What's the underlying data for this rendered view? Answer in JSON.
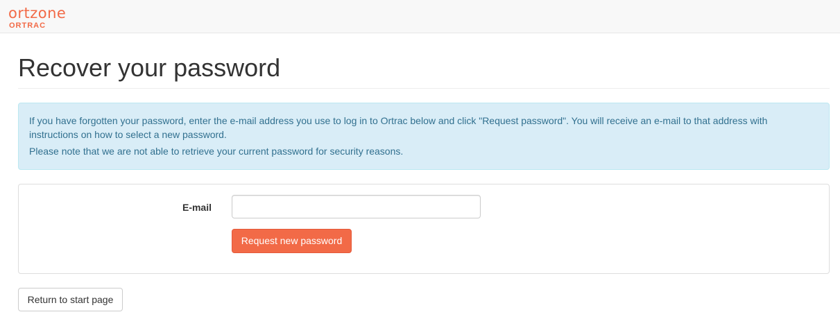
{
  "header": {
    "logo_main": "ortzone",
    "logo_sub": "ORTRAC"
  },
  "page": {
    "title": "Recover your password"
  },
  "info": {
    "paragraph1": "If you have forgotten your password, enter the e-mail address you use to log in to Ortrac below and click \"Request password\". You will receive an e-mail to that address with instructions on how to select a new password.",
    "paragraph2": "Please note that we are not able to retrieve your current password for security reasons."
  },
  "form": {
    "email_label": "E-mail",
    "email_value": "",
    "request_button_label": "Request new password"
  },
  "footer": {
    "return_button_label": "Return to start page"
  },
  "colors": {
    "brand": "#f26a47",
    "info_background": "#d9edf7",
    "info_text": "#31708f"
  }
}
